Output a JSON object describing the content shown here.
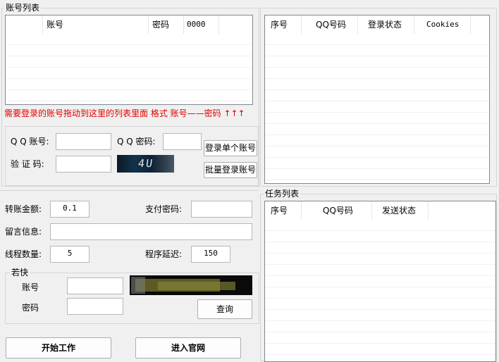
{
  "account_list": {
    "title": "账号列表",
    "columns": [
      "",
      "账号",
      "密码",
      "0000",
      ""
    ]
  },
  "hint_text": "需要登录的账号拖动到这里的列表里面 格式 账号——密码 ↑↑↑",
  "login_panel": {
    "qq_account_label": "Q Q 账号:",
    "qq_account_value": "",
    "qq_password_label": "Q Q 密码:",
    "qq_password_value": "",
    "captcha_label": "验 证 码:",
    "captcha_value": "",
    "captcha_image_text": "4U",
    "login_single_button": "登录单个账号",
    "batch_login_button": "批量登录账号"
  },
  "login_status_list": {
    "columns": [
      "序号",
      "QQ号码",
      "登录状态",
      "Cookies"
    ]
  },
  "transfer_panel": {
    "amount_label": "转账金额:",
    "amount_value": "0.1",
    "pay_password_label": "支付密码:",
    "pay_password_value": "",
    "message_label": "留言信息:",
    "message_value": "",
    "thread_count_label": "线程数量:",
    "thread_count_value": "5",
    "delay_label": "程序延迟:",
    "delay_value": "150"
  },
  "ruokuai": {
    "title": "若快",
    "account_label": "账号",
    "account_value": "",
    "password_label": "密码",
    "password_value": "",
    "query_button": "查询"
  },
  "task_list": {
    "title": "任务列表",
    "columns": [
      "序号",
      "QQ号码",
      "发送状态"
    ]
  },
  "actions": {
    "start_button": "开始工作",
    "website_button": "进入官网"
  }
}
